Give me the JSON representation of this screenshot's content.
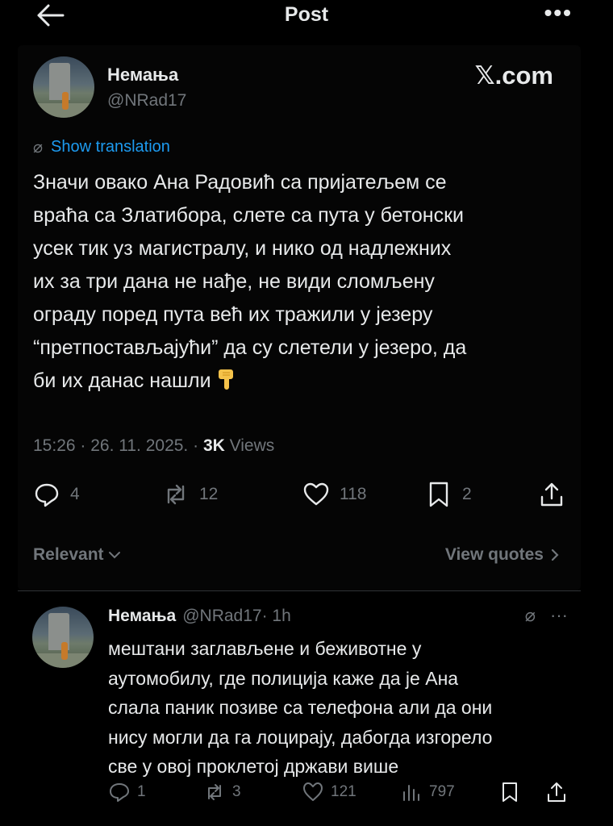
{
  "header": {
    "title": "Post",
    "more": "•••"
  },
  "post": {
    "author_name": "Немања",
    "author_handle": "@NRad17",
    "watermark": "𝕏.com",
    "translate_label": "Show translation",
    "text": "Значи овако Ана Радовић са пријатељем се\nвраћа са Златибора, слете са пута у бетонски\nусек тик уз магистралу, и нико од надлежних\nих за три дана не нађе, не види сломљену\nограду поред пута већ их тражили у језеру\n“претпостављајући” да су слетели у језеро, да\nби их данас нашли",
    "timestamp": "15:26 · 26. 11. 2025. · ",
    "views_count": "3K",
    "views_label": " Views",
    "replies": "4",
    "reposts": "12",
    "likes": "118",
    "bookmarks": "2"
  },
  "sort": {
    "relevant_label": "Relevant",
    "view_quotes_label": "View quotes"
  },
  "reply": {
    "author_name": "Немања",
    "author_handle": "@NRad17",
    "time": "· 1h",
    "more": "···",
    "text": "мештани заглављене и беживотне у\nаутомобилу, где полиција каже да је Ана\nслала паник позиве са телефона али да они\nнису могли да га лоцирају, дабогда изгорело\nсве у овој проклетој држави више",
    "replies": "1",
    "reposts": "3",
    "likes": "121",
    "views": "797"
  },
  "colors": {
    "background": "#000000",
    "text": "#e7e9ea",
    "muted": "#71767b",
    "link": "#1d9bf0"
  }
}
